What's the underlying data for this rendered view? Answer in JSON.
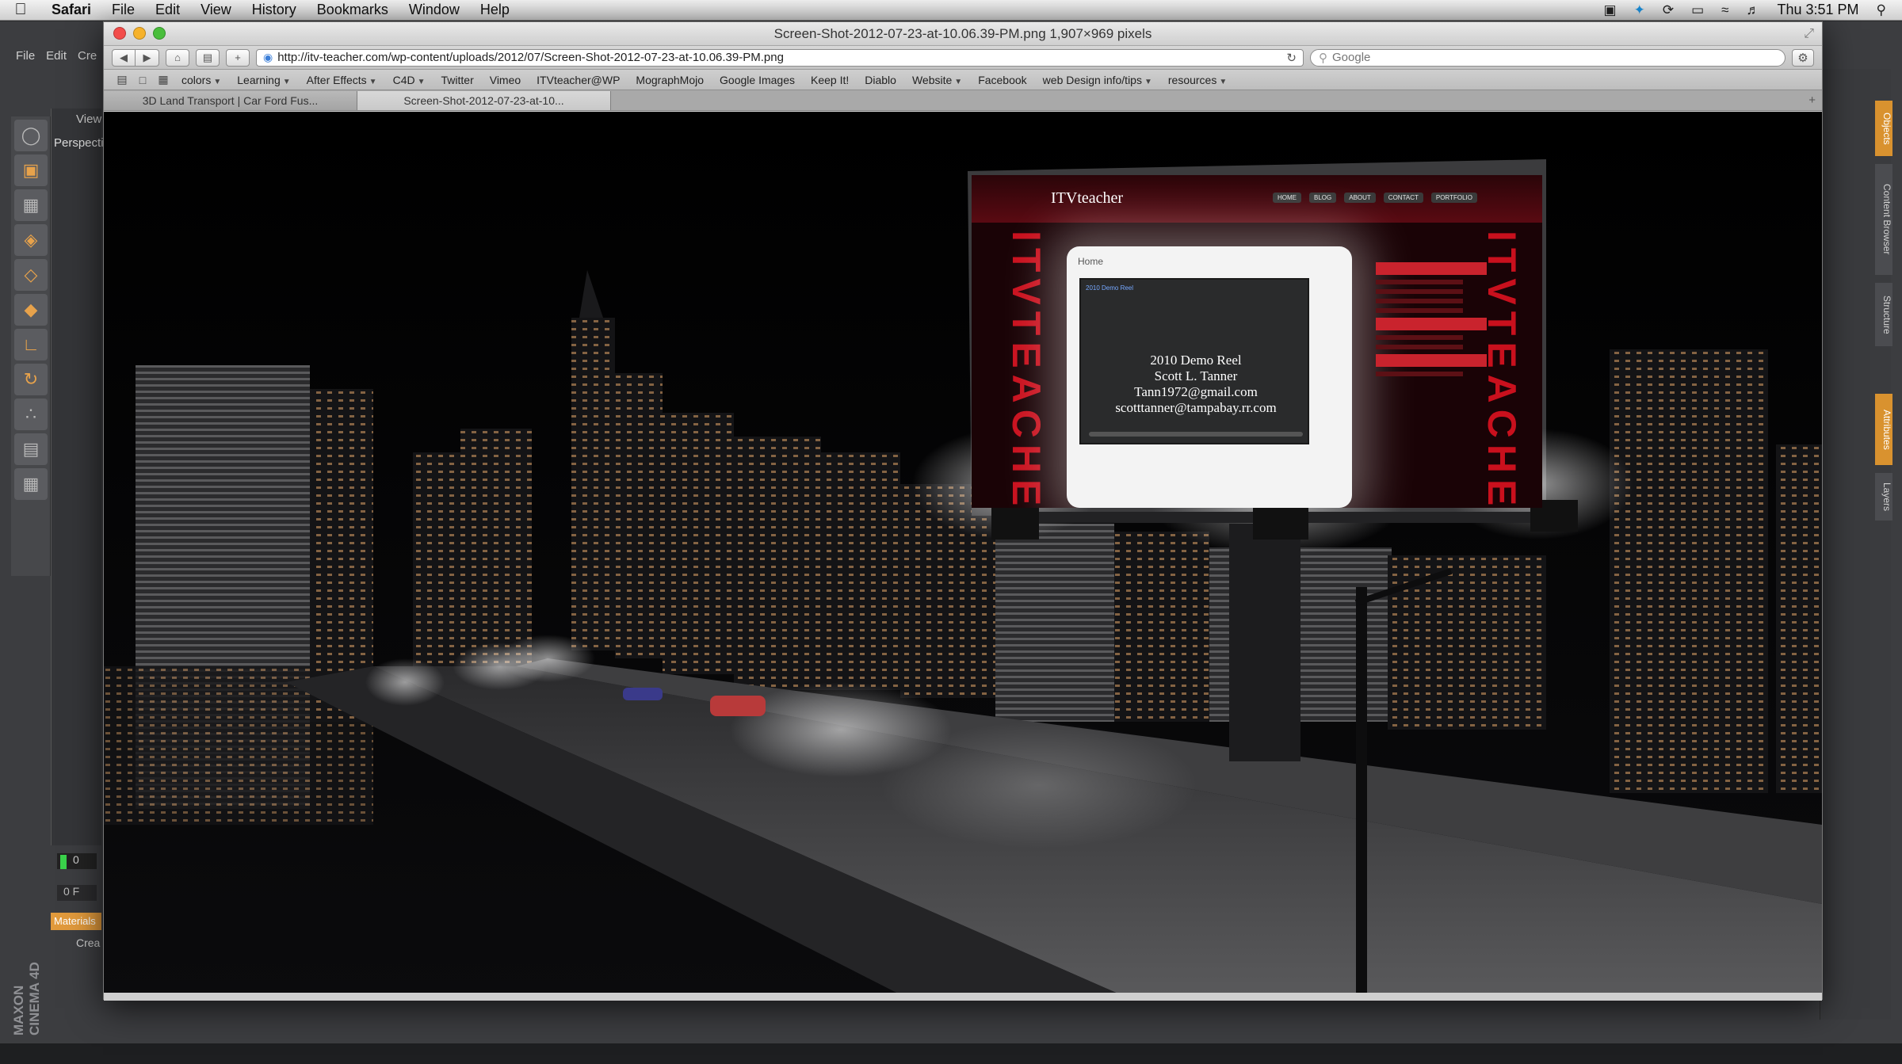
{
  "menubar": {
    "app_name": "Safari",
    "items": [
      "File",
      "Edit",
      "View",
      "History",
      "Bookmarks",
      "Window",
      "Help"
    ],
    "clock": "Thu 3:51 PM"
  },
  "c4d": {
    "menu": [
      "File",
      "Edit",
      "Cre"
    ],
    "view_label": "View",
    "perspective_label": "Perspecti",
    "frame_value": "0",
    "of_value": "0 F",
    "materials_tab": "Materials",
    "create_label": "Crea",
    "brand": "MAXON CINEMA 4D",
    "side_tabs": [
      "Objects",
      "Content Browser",
      "Structure",
      "Attributes",
      "Layers"
    ]
  },
  "window": {
    "title": "Screen-Shot-2012-07-23-at-10.06.39-PM.png 1,907×969 pixels"
  },
  "toolbar": {
    "url": "http://itv-teacher.com/wp-content/uploads/2012/07/Screen-Shot-2012-07-23-at-10.06.39-PM.png",
    "search_placeholder": "Google"
  },
  "bookmarks": [
    {
      "label": "colors",
      "menu": true
    },
    {
      "label": "Learning",
      "menu": true
    },
    {
      "label": "After Effects",
      "menu": true
    },
    {
      "label": "C4D",
      "menu": true
    },
    {
      "label": "Twitter",
      "menu": false
    },
    {
      "label": "Vimeo",
      "menu": false
    },
    {
      "label": "ITVteacher@WP",
      "menu": false
    },
    {
      "label": "MographMojo",
      "menu": false
    },
    {
      "label": "Google Images",
      "menu": false
    },
    {
      "label": "Keep It!",
      "menu": false
    },
    {
      "label": "Diablo",
      "menu": false
    },
    {
      "label": "Website",
      "menu": true
    },
    {
      "label": "Facebook",
      "menu": false
    },
    {
      "label": "web Design info/tips",
      "menu": true
    },
    {
      "label": "resources",
      "menu": true
    }
  ],
  "tabs": [
    {
      "label": "3D Land Transport | Car Ford Fus...",
      "active": false
    },
    {
      "label": "Screen-Shot-2012-07-23-at-10...",
      "active": true
    }
  ],
  "billboard": {
    "site_name": "ITVteacher",
    "nav": [
      "HOME",
      "BLOG",
      "ABOUT",
      "CONTACT",
      "PORTFOLIO"
    ],
    "vertical_text": "ITVTEACHER",
    "home_label": "Home",
    "video_tag": "2010 Demo Reel",
    "video_lines": [
      "2010 Demo Reel",
      "Scott L. Tanner",
      "Tann1972@gmail.com",
      "scotttanner@tampabay.rr.com"
    ]
  },
  "colors": {
    "accent_red": "#d3111f",
    "c4d_orange": "#e19a3c"
  }
}
